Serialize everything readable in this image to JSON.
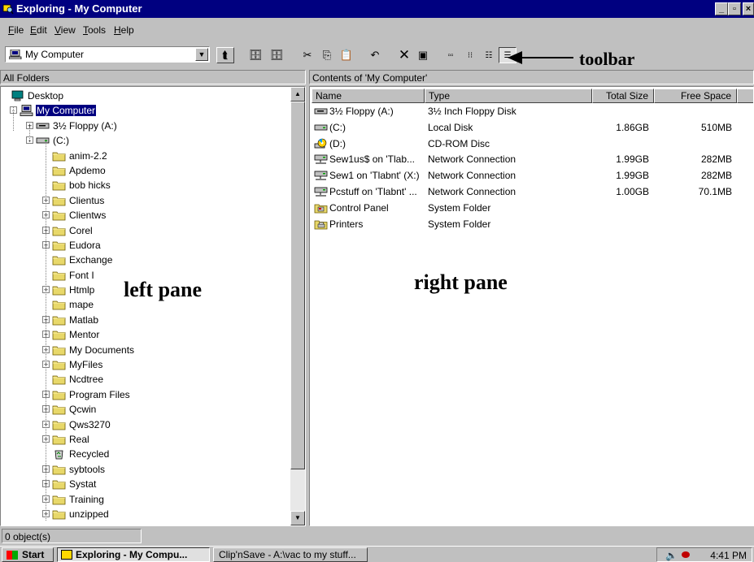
{
  "window": {
    "title": "Exploring - My Computer"
  },
  "menu": [
    "File",
    "Edit",
    "View",
    "Tools",
    "Help"
  ],
  "address": {
    "value": "My Computer"
  },
  "annotations": {
    "toolbar": "toolbar",
    "left": "left pane",
    "right": "right pane"
  },
  "left_header": "All Folders",
  "right_header": "Contents of 'My Computer'",
  "tree": [
    {
      "label": "Desktop",
      "level": 0,
      "expander": "",
      "icon": "desktop-icon"
    },
    {
      "label": "My Computer",
      "level": 1,
      "expander": "-",
      "icon": "computer-icon",
      "selected": true
    },
    {
      "label": "3½ Floppy (A:)",
      "level": 2,
      "expander": "+",
      "icon": "floppy-drive-icon"
    },
    {
      "label": "(C:)",
      "level": 2,
      "expander": "-",
      "icon": "hard-drive-icon"
    },
    {
      "label": "anim-2.2",
      "level": 3,
      "expander": "",
      "icon": "folder-icon"
    },
    {
      "label": "Apdemo",
      "level": 3,
      "expander": "",
      "icon": "folder-icon"
    },
    {
      "label": "bob hicks",
      "level": 3,
      "expander": "",
      "icon": "folder-icon"
    },
    {
      "label": "Clientus",
      "level": 3,
      "expander": "+",
      "icon": "folder-icon"
    },
    {
      "label": "Clientws",
      "level": 3,
      "expander": "+",
      "icon": "folder-icon"
    },
    {
      "label": "Corel",
      "level": 3,
      "expander": "+",
      "icon": "folder-icon"
    },
    {
      "label": "Eudora",
      "level": 3,
      "expander": "+",
      "icon": "folder-icon"
    },
    {
      "label": "Exchange",
      "level": 3,
      "expander": "",
      "icon": "folder-icon"
    },
    {
      "label": "Font I",
      "level": 3,
      "expander": "",
      "icon": "folder-icon"
    },
    {
      "label": "Htmlp",
      "level": 3,
      "expander": "+",
      "icon": "folder-icon"
    },
    {
      "label": "mape",
      "level": 3,
      "expander": "",
      "icon": "folder-icon"
    },
    {
      "label": "Matlab",
      "level": 3,
      "expander": "+",
      "icon": "folder-icon"
    },
    {
      "label": "Mentor",
      "level": 3,
      "expander": "+",
      "icon": "folder-icon"
    },
    {
      "label": "My Documents",
      "level": 3,
      "expander": "+",
      "icon": "folder-icon"
    },
    {
      "label": "MyFiles",
      "level": 3,
      "expander": "+",
      "icon": "folder-icon"
    },
    {
      "label": "Ncdtree",
      "level": 3,
      "expander": "",
      "icon": "folder-icon"
    },
    {
      "label": "Program Files",
      "level": 3,
      "expander": "+",
      "icon": "folder-icon"
    },
    {
      "label": "Qcwin",
      "level": 3,
      "expander": "+",
      "icon": "folder-icon"
    },
    {
      "label": "Qws3270",
      "level": 3,
      "expander": "+",
      "icon": "folder-icon"
    },
    {
      "label": "Real",
      "level": 3,
      "expander": "+",
      "icon": "folder-icon"
    },
    {
      "label": "Recycled",
      "level": 3,
      "expander": "",
      "icon": "recycle-bin-icon"
    },
    {
      "label": "sybtools",
      "level": 3,
      "expander": "+",
      "icon": "folder-icon"
    },
    {
      "label": "Systat",
      "level": 3,
      "expander": "+",
      "icon": "folder-icon"
    },
    {
      "label": "Training",
      "level": 3,
      "expander": "+",
      "icon": "folder-icon"
    },
    {
      "label": "unzipped",
      "level": 3,
      "expander": "+",
      "icon": "folder-icon"
    }
  ],
  "columns": {
    "name": "Name",
    "type": "Type",
    "total": "Total Size",
    "free": "Free Space"
  },
  "rows": [
    {
      "name": "3½ Floppy (A:)",
      "type": "3½ Inch Floppy Disk",
      "total": "",
      "free": "",
      "icon": "floppy-drive-icon"
    },
    {
      "name": "(C:)",
      "type": "Local Disk",
      "total": "1.86GB",
      "free": "510MB",
      "icon": "hard-drive-icon"
    },
    {
      "name": "(D:)",
      "type": "CD-ROM Disc",
      "total": "",
      "free": "",
      "icon": "cd-rom-icon"
    },
    {
      "name": "Sew1us$ on 'Tlab...",
      "type": "Network Connection",
      "total": "1.99GB",
      "free": "282MB",
      "icon": "network-drive-icon"
    },
    {
      "name": "Sew1 on 'Tlabnt' (X:)",
      "type": "Network Connection",
      "total": "1.99GB",
      "free": "282MB",
      "icon": "network-drive-icon"
    },
    {
      "name": "Pcstuff on 'Tlabnt' ...",
      "type": "Network Connection",
      "total": "1.00GB",
      "free": "70.1MB",
      "icon": "network-drive-icon"
    },
    {
      "name": "Control Panel",
      "type": "System Folder",
      "total": "",
      "free": "",
      "icon": "control-panel-icon"
    },
    {
      "name": "Printers",
      "type": "System Folder",
      "total": "",
      "free": "",
      "icon": "printers-icon"
    }
  ],
  "status": {
    "objects": "0 object(s)"
  },
  "taskbar": {
    "start": "Start",
    "tasks": [
      "Exploring - My Compu...",
      "Clip'nSave - A:\\vac to my stuff..."
    ],
    "clock": "4:41 PM"
  }
}
